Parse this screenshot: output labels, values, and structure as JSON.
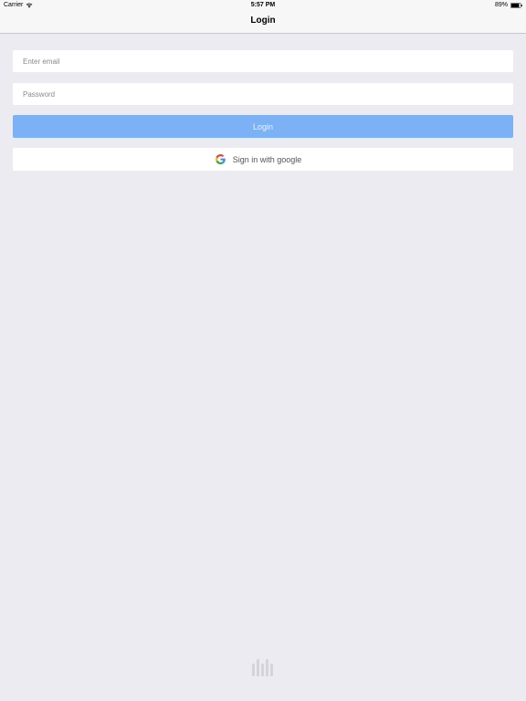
{
  "status_bar": {
    "carrier": "Carrier",
    "time": "5:57 PM",
    "battery": "89%",
    "battery_level": 0.89
  },
  "nav": {
    "title": "Login"
  },
  "form": {
    "email": {
      "placeholder": "Enter email",
      "value": ""
    },
    "password": {
      "placeholder": "Password",
      "value": ""
    },
    "login_label": "Login",
    "google_label": "Sign in with google"
  },
  "icons": {
    "wifi": "wifi-icon",
    "battery": "battery-icon",
    "google": "google-icon",
    "watermark": "lili-logo-icon"
  },
  "colors": {
    "background": "#ebebf1",
    "login_button": "#7cb1f5",
    "google_blue": "#4285F4",
    "google_red": "#EA4335",
    "google_yellow": "#FBBC05",
    "google_green": "#34A853"
  }
}
